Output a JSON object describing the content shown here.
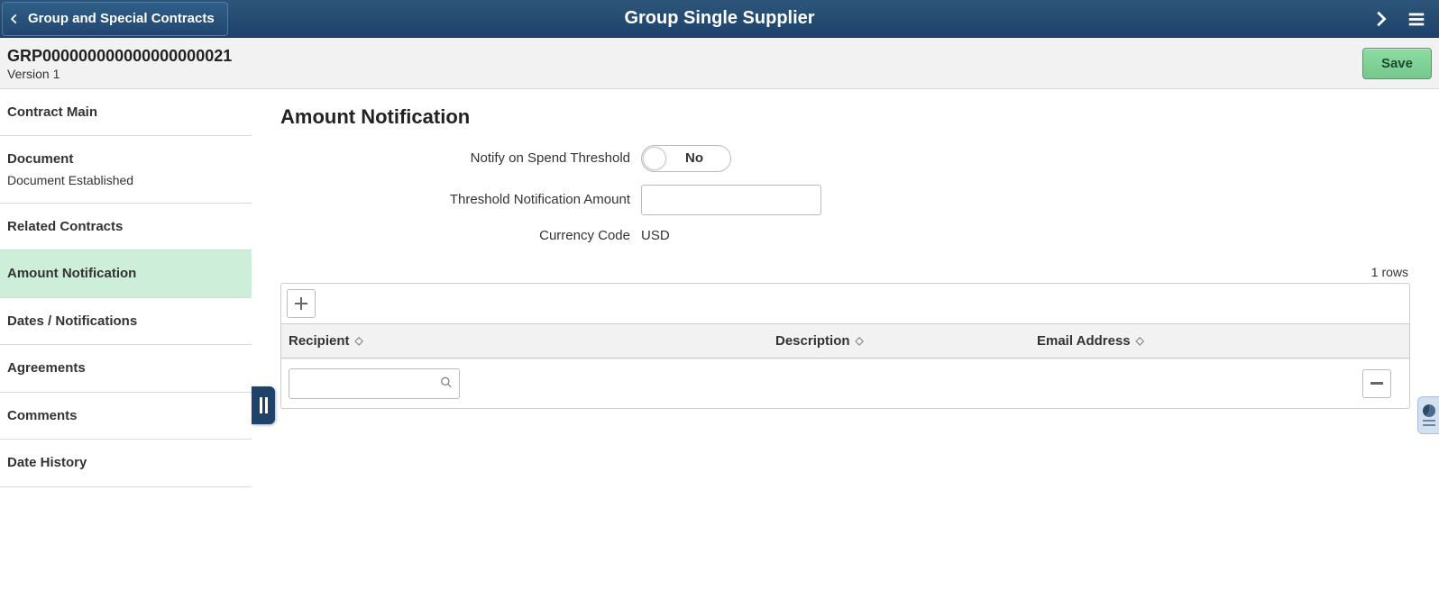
{
  "header": {
    "back_label": "Group and Special Contracts",
    "title": "Group Single Supplier"
  },
  "subheader": {
    "doc_id": "GRP000000000000000000021",
    "version": "Version 1",
    "save_label": "Save"
  },
  "sidebar": {
    "items": [
      {
        "label": "Contract Main",
        "subtext": ""
      },
      {
        "label": "Document",
        "subtext": "Document Established"
      },
      {
        "label": "Related Contracts",
        "subtext": ""
      },
      {
        "label": "Amount Notification",
        "subtext": ""
      },
      {
        "label": "Dates / Notifications",
        "subtext": ""
      },
      {
        "label": "Agreements",
        "subtext": ""
      },
      {
        "label": "Comments",
        "subtext": ""
      },
      {
        "label": "Date History",
        "subtext": ""
      }
    ]
  },
  "page": {
    "title": "Amount Notification",
    "labels": {
      "notify": "Notify on Spend Threshold",
      "threshold": "Threshold Notification Amount",
      "currency": "Currency Code"
    },
    "values": {
      "notify_toggle": "No",
      "threshold_amount": "",
      "currency_code": "USD"
    },
    "grid": {
      "rows_text": "1 rows",
      "columns": {
        "recipient": "Recipient",
        "description": "Description",
        "email": "Email Address"
      },
      "rows": [
        {
          "recipient": "",
          "description": "",
          "email": ""
        }
      ]
    }
  }
}
